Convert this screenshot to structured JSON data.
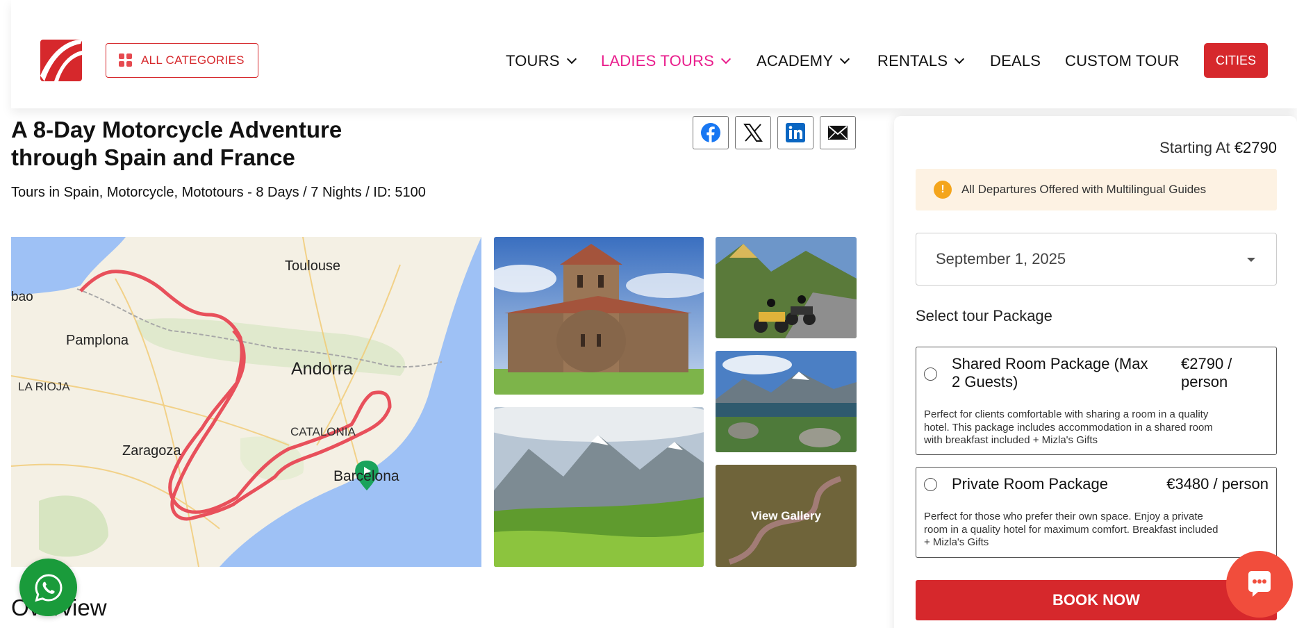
{
  "header": {
    "all_categories": "ALL CATEGORIES",
    "nav": [
      {
        "label": "TOURS",
        "has_dropdown": true,
        "active": false
      },
      {
        "label": "LADIES TOURS",
        "has_dropdown": true,
        "active": true
      },
      {
        "label": "ACADEMY",
        "has_dropdown": true,
        "active": false
      },
      {
        "label": "RENTALS",
        "has_dropdown": true,
        "active": false
      },
      {
        "label": "DEALS",
        "has_dropdown": false,
        "active": false
      },
      {
        "label": "CUSTOM TOUR",
        "has_dropdown": false,
        "active": false
      }
    ],
    "cities": "CITIES"
  },
  "tour": {
    "title": "A 8-Day Motorcycle Adventure through Spain and France",
    "subtitle": "Tours in Spain, Motorcycle, Mototours - 8 Days / 7 Nights / ID: 5100"
  },
  "share": [
    "facebook-icon",
    "x-icon",
    "linkedin-icon",
    "email-icon"
  ],
  "map": {
    "labels": [
      "Toulouse",
      "bao",
      "Pamplona",
      "Andorra",
      "LA RIOJA",
      "CATALONIA",
      "Zaragoza",
      "Barcelona"
    ]
  },
  "gallery": {
    "view_gallery": "View Gallery"
  },
  "overview_heading": "Overview",
  "booking": {
    "starting_at_label": "Starting At",
    "starting_price": "€2790",
    "notice": "All Departures Offered with Multilingual Guides",
    "date": "September 1, 2025",
    "select_package_label": "Select tour Package",
    "packages": [
      {
        "name_line1": "Shared Room Package (Max",
        "name_line2": "2 Guests)",
        "price_line1": "€2790 /",
        "price_line2": "person",
        "desc_line1": "Perfect for clients comfortable with sharing a room in a quality",
        "desc_line2": "hotel. This package includes accommodation in a shared room",
        "desc_line3": "with breakfast included + Mizla's Gifts"
      },
      {
        "name_line1": "Private Room Package",
        "price_line1": "€3480 / person",
        "desc_line1": "Perfect for those who prefer their own space. Enjoy a private",
        "desc_line2": "room in a quality hotel for maximum comfort. Breakfast included",
        "desc_line3": "+ Mizla's Gifts"
      }
    ],
    "book_now": "BOOK NOW"
  },
  "colors": {
    "brand_red": "#d6282c",
    "active_nav": "#e91e8c",
    "route": "#e8505b",
    "whatsapp": "#1a9b3b",
    "chat": "#f14d3c"
  }
}
